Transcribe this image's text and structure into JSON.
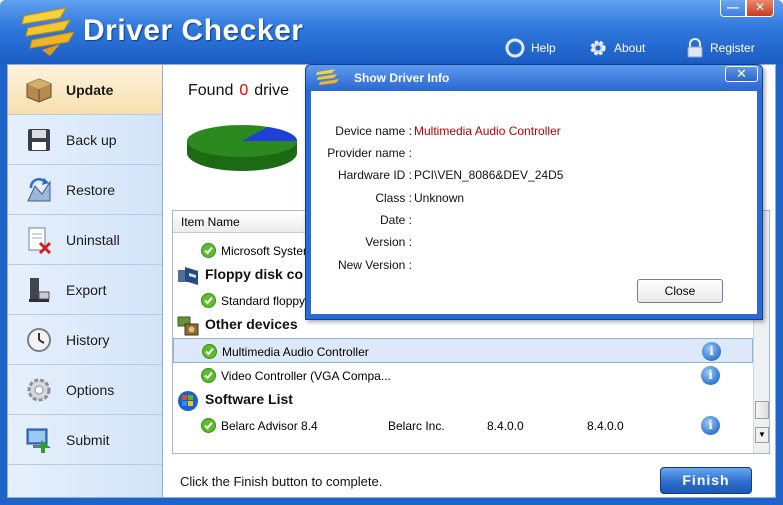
{
  "app": {
    "title": "Driver Checker",
    "window_min": "—",
    "window_close": "✕"
  },
  "top_menu": {
    "help": "Help",
    "about": "About",
    "register": "Register"
  },
  "sidebar": {
    "items": [
      {
        "label": "Update",
        "icon": "box-icon",
        "active": true
      },
      {
        "label": "Back up",
        "icon": "floppy-icon"
      },
      {
        "label": "Restore",
        "icon": "restore-icon"
      },
      {
        "label": "Uninstall",
        "icon": "uninstall-icon"
      },
      {
        "label": "Export",
        "icon": "export-icon"
      },
      {
        "label": "History",
        "icon": "clock-icon"
      },
      {
        "label": "Options",
        "icon": "gear-icon"
      },
      {
        "label": "Submit",
        "icon": "submit-icon"
      }
    ]
  },
  "main": {
    "found_prefix": "Found",
    "found_count": "0",
    "found_suffix": "drive",
    "list_header": "Item Name",
    "rows": [
      {
        "kind": "item",
        "name": "Microsoft System"
      },
      {
        "kind": "group",
        "label": "Floppy disk co",
        "icon": "floppy-drive-icon"
      },
      {
        "kind": "item",
        "name": "Standard floppy d"
      },
      {
        "kind": "group",
        "label": "Other devices",
        "icon": "devices-icon"
      },
      {
        "kind": "item",
        "name": "Multimedia Audio Controller",
        "info": true,
        "selected": true
      },
      {
        "kind": "item",
        "name": "Video Controller (VGA Compa...",
        "info": true
      },
      {
        "kind": "group",
        "label": "Software List",
        "icon": "windows-icon"
      },
      {
        "kind": "item",
        "name": "Belarc Advisor 8.4",
        "publisher": "Belarc Inc.",
        "current_version": "8.4.0.0",
        "new_version": "8.4.0.0",
        "info": true
      }
    ],
    "status": "Click the Finish button to complete.",
    "finish_label": "Finish"
  },
  "dialog": {
    "title": "Show Driver Info",
    "close_glyph": "✕",
    "fields": [
      {
        "label": "Device name :",
        "value": "Multimedia Audio Controller",
        "highlight": true
      },
      {
        "label": "Provider name :",
        "value": ""
      },
      {
        "label": "Hardware ID :",
        "value": "PCI\\VEN_8086&DEV_24D5"
      },
      {
        "label": "Class :",
        "value": "Unknown"
      },
      {
        "label": "Date :",
        "value": ""
      },
      {
        "label": "Version :",
        "value": ""
      },
      {
        "label": "New Version :",
        "value": ""
      }
    ],
    "close_button": "Close"
  },
  "colors": {
    "accent": "#1f62c8",
    "found_count": "#e60000",
    "device_name": "#b30000",
    "pie_green": "#2a8a1f",
    "pie_blue": "#1f3fd6"
  }
}
